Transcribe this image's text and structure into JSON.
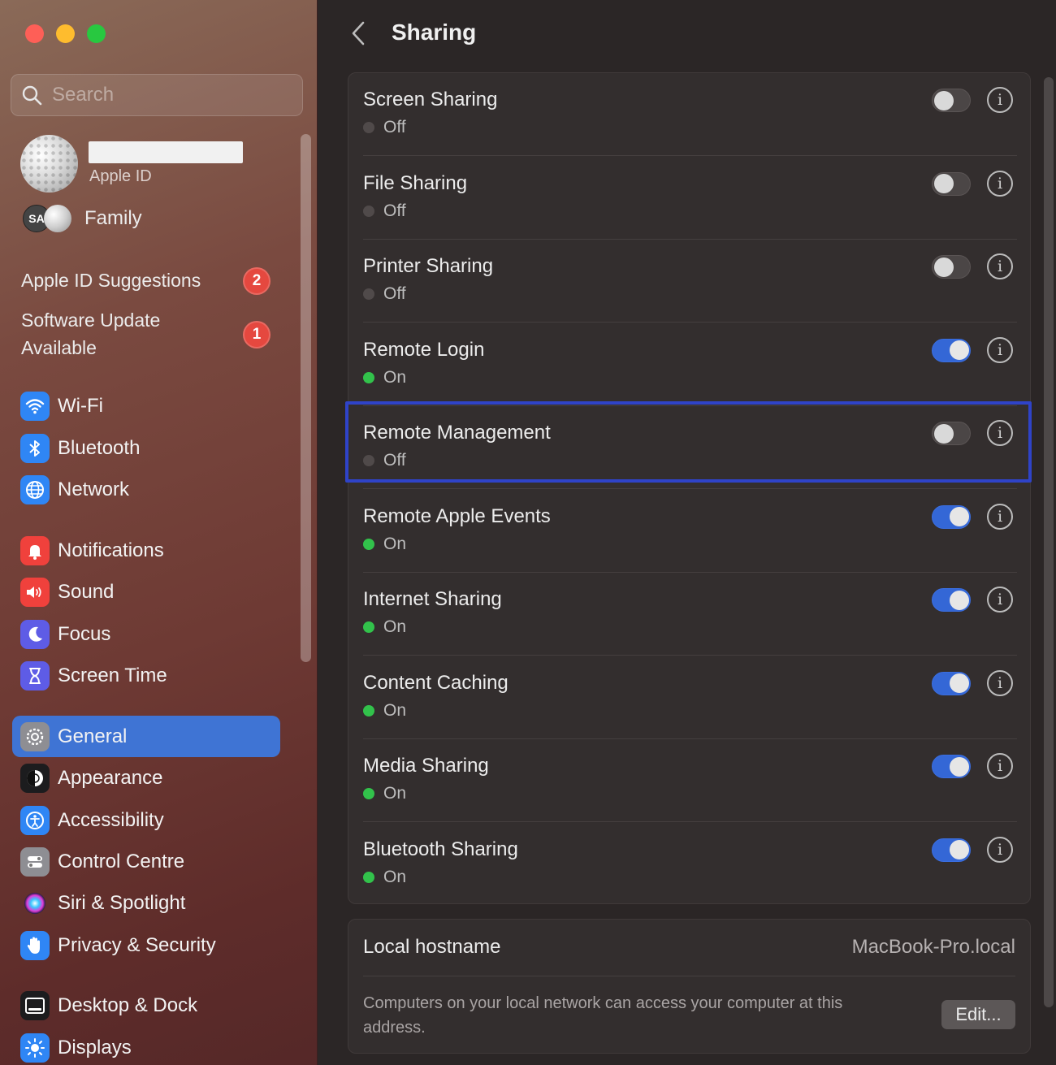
{
  "window": {
    "title": "Sharing"
  },
  "sidebar": {
    "search_placeholder": "Search",
    "profile": {
      "subtitle": "Apple ID",
      "family_initials": "SA",
      "family_label": "Family"
    },
    "suggestions": [
      {
        "label": "Apple ID Suggestions",
        "badge": "2"
      },
      {
        "label_line1": "Software Update",
        "label_line2": "Available",
        "badge": "1"
      }
    ],
    "items": [
      {
        "label": "Wi-Fi",
        "icon": "wifi-icon",
        "color": "#2f86f5"
      },
      {
        "label": "Bluetooth",
        "icon": "bluetooth-icon",
        "color": "#2f86f5"
      },
      {
        "label": "Network",
        "icon": "globe-icon",
        "color": "#2f86f5"
      },
      {
        "label": "Notifications",
        "icon": "bell-icon",
        "color": "#f0413c"
      },
      {
        "label": "Sound",
        "icon": "speaker-icon",
        "color": "#f0413c"
      },
      {
        "label": "Focus",
        "icon": "moon-icon",
        "color": "#5e5ce6"
      },
      {
        "label": "Screen Time",
        "icon": "hourglass-icon",
        "color": "#5e5ce6"
      },
      {
        "label": "General",
        "icon": "gear-icon",
        "color": "#8e8e93",
        "active": true
      },
      {
        "label": "Appearance",
        "icon": "appearance-icon",
        "color": "#1c1c1e"
      },
      {
        "label": "Accessibility",
        "icon": "accessibility-icon",
        "color": "#2f86f5"
      },
      {
        "label": "Control Centre",
        "icon": "control-centre-icon",
        "color": "#8e8e93"
      },
      {
        "label": "Siri & Spotlight",
        "icon": "siri-icon",
        "color": "#7a3fe0"
      },
      {
        "label": "Privacy & Security",
        "icon": "hand-icon",
        "color": "#2f86f5"
      },
      {
        "label": "Desktop & Dock",
        "icon": "dock-icon",
        "color": "#1c1c1e"
      },
      {
        "label": "Displays",
        "icon": "sun-icon",
        "color": "#2f86f5"
      }
    ]
  },
  "sharing": {
    "services": [
      {
        "name": "Screen Sharing",
        "status": "Off",
        "enabled": false
      },
      {
        "name": "File Sharing",
        "status": "Off",
        "enabled": false
      },
      {
        "name": "Printer Sharing",
        "status": "Off",
        "enabled": false
      },
      {
        "name": "Remote Login",
        "status": "On",
        "enabled": true
      },
      {
        "name": "Remote Management",
        "status": "Off",
        "enabled": false,
        "highlighted": true
      },
      {
        "name": "Remote Apple Events",
        "status": "On",
        "enabled": true
      },
      {
        "name": "Internet Sharing",
        "status": "On",
        "enabled": true
      },
      {
        "name": "Content Caching",
        "status": "On",
        "enabled": true
      },
      {
        "name": "Media Sharing",
        "status": "On",
        "enabled": true
      },
      {
        "name": "Bluetooth Sharing",
        "status": "On",
        "enabled": true
      }
    ],
    "info_glyph": "i",
    "hostname": {
      "label": "Local hostname",
      "value": "MacBook-Pro.local",
      "description": "Computers on your local network can access your computer at this address.",
      "edit_label": "Edit..."
    }
  },
  "colors": {
    "accent": "#3f74d4",
    "toggle_on": "#3467d6",
    "status_on": "#32c24b",
    "highlight_border": "#2f43c8",
    "badge": "#e5483f"
  }
}
